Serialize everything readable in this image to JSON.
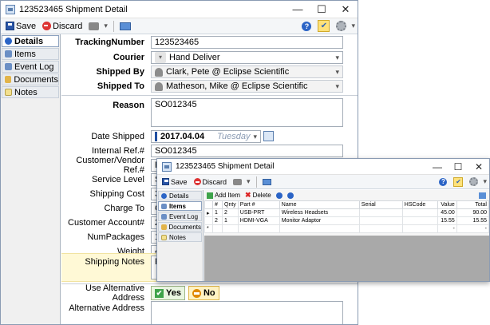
{
  "main_window": {
    "title": "123523465 Shipment Detail",
    "toolbar": {
      "save": "Save",
      "discard": "Discard"
    },
    "sidebar": [
      {
        "label": "Details",
        "icon": "info-icon"
      },
      {
        "label": "Items",
        "icon": "items-icon"
      },
      {
        "label": "Event Log",
        "icon": "event-log-icon"
      },
      {
        "label": "Documents",
        "icon": "documents-icon"
      },
      {
        "label": "Notes",
        "icon": "notes-icon"
      }
    ],
    "form": {
      "tracking_label": "TrackingNumber",
      "tracking_value": "123523465",
      "courier_label": "Courier",
      "courier_value": "Hand Deliver",
      "shipped_by_label": "Shipped By",
      "shipped_by_value": "Clark, Pete @ Eclipse Scientific",
      "shipped_to_label": "Shipped To",
      "shipped_to_value": "Matheson, Mike @ Eclipse Scientific",
      "reason_label": "Reason",
      "reason_value": "SO012345",
      "date_label": "Date Shipped",
      "date_value": "2017.04.04",
      "date_day": "Tuesday",
      "internal_ref_label": "Internal Ref.#",
      "internal_ref_value": "SO012345",
      "vendor_ref_label": "Customer/Vendor Ref.#",
      "vendor_ref_value": "P",
      "service_level_label": "Service Level",
      "service_level_value": "S",
      "shipping_cost_label": "Shipping Cost",
      "shipping_cost_value": "3",
      "charge_to_label": "Charge To",
      "charge_to_value": "C",
      "customer_account_label": "Customer Account#",
      "customer_account_value": "2",
      "num_packages_label": "NumPackages",
      "num_packages_value": "1",
      "weight_label": "Weight",
      "weight_value": "4.",
      "shipping_notes_label": "Shipping Notes",
      "shipping_notes_value": "F",
      "use_alt_label": "Use Alternative Address",
      "yes": "Yes",
      "no": "No",
      "alt_address_label": "Alternative Address"
    }
  },
  "items_window": {
    "title": "123523465 Shipment Detail",
    "toolbar": {
      "save": "Save",
      "discard": "Discard"
    },
    "sidebar": [
      {
        "label": "Details"
      },
      {
        "label": "Items"
      },
      {
        "label": "Event Log"
      },
      {
        "label": "Documents"
      },
      {
        "label": "Notes"
      }
    ],
    "grid_toolbar": {
      "add": "Add Item",
      "delete": "Delete"
    },
    "columns": [
      "#",
      "Qnty",
      "Part #",
      "Name",
      "Serial",
      "HSCode",
      "Value",
      "Total"
    ],
    "rows": [
      {
        "num": "1",
        "qty": "2",
        "part": "USB-PRT",
        "name": "Wireless  Headsets",
        "serial": "",
        "hscode": "",
        "value": "45.00",
        "total": "90.00"
      },
      {
        "num": "2",
        "qty": "1",
        "part": "HDMI-VGA",
        "name": "Monitor Adaptor",
        "serial": "",
        "hscode": "",
        "value": "15.55",
        "total": "15.55"
      }
    ],
    "new_row_marker": "*",
    "empty_value": "-",
    "empty_total": "-"
  }
}
